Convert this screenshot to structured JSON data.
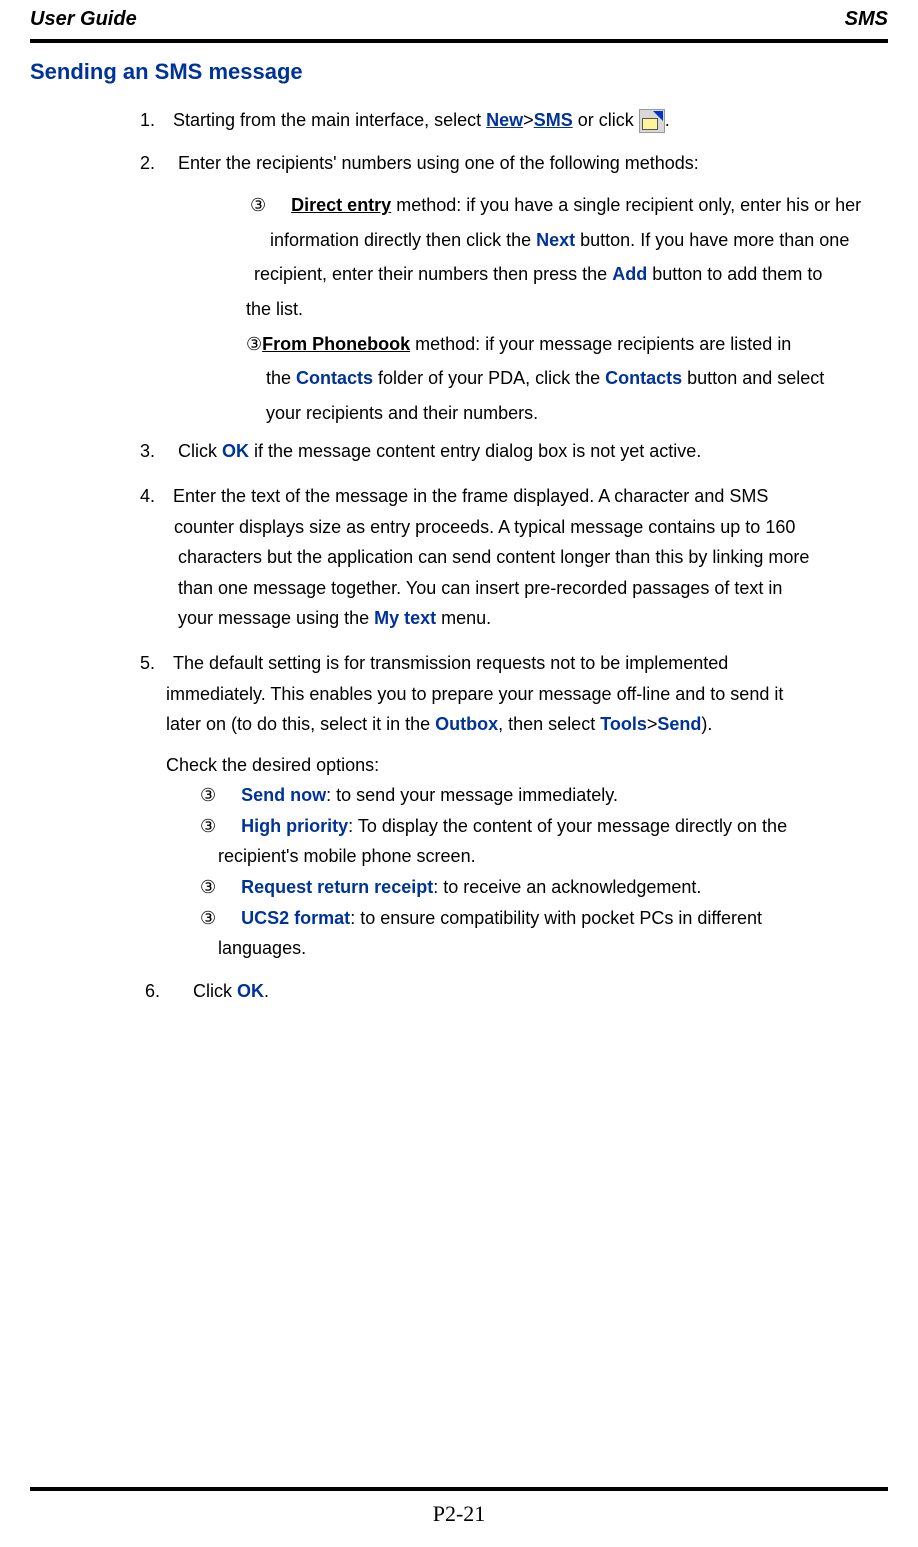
{
  "header": {
    "left": "User Guide",
    "right": "SMS"
  },
  "title": "Sending an SMS message",
  "steps": {
    "s1": {
      "num": "1.",
      "a": "Starting from the main interface, select ",
      "new": "New",
      "gt": ">",
      "sms": "SMS",
      "b": " or click  ",
      "end": "."
    },
    "s2": {
      "num": "2.",
      "text": "Enter the recipients' numbers using one of the following methods:",
      "bullet": "③",
      "direct_label": "Direct entry",
      "direct_a": " method: if you have a single recipient only, enter his or her",
      "direct_b": "information directly then click the ",
      "next": "Next",
      "direct_c": " button. If you have more than one",
      "direct_d": "recipient, enter their numbers then press the ",
      "add": "Add",
      "direct_e": " button to add them to",
      "direct_f": "the list.",
      "phonebook_label": "From Phonebook",
      "pb_a": " method: if your message recipients are listed in",
      "pb_b": "the ",
      "contacts": "Contacts",
      "pb_c": " folder of your PDA, click the ",
      "pb_d": " button and select",
      "pb_e": "your recipients and their numbers."
    },
    "s3": {
      "num": "3.",
      "a": "Click ",
      "ok": "OK",
      "b": " if the message content entry dialog box is not yet active."
    },
    "s4": {
      "num": "4.",
      "l1": "Enter the text of the message in the frame displayed. A character and SMS",
      "l2": "counter displays size as entry proceeds. A typical message contains up to 160",
      "l3": "characters but the application can send content longer than this by linking more",
      "l4": "than one message    together. You can insert pre-recorded passages of text in",
      "l5": "your message using the ",
      "mytext": "My text",
      "l5b": " menu."
    },
    "s5": {
      "num": "5.",
      "l1": "The default setting is for transmission requests not to be implemented",
      "l2": "immediately. This enables you to prepare your message off-line and to send it",
      "l3a": "later on (to do this, select it in the ",
      "outbox": "Outbox",
      "l3b": ", then select ",
      "tools": "Tools",
      "gt": ">",
      "send": "Send",
      "l3c": ").",
      "check": "Check the desired options:",
      "bullet": "③",
      "opt1_label": "Send now",
      "opt1_rest": ": to send your message immediately.",
      "opt2_label": "High priority",
      "opt2_rest": ": To display the content of your message directly on the",
      "opt2_cont": "recipient's mobile phone screen.",
      "opt3_label": "Request return receipt",
      "opt3_rest": ": to receive an acknowledgement.",
      "opt4_label": "UCS2 format",
      "opt4_rest": ": to ensure compatibility with pocket PCs in different",
      "opt4_cont": "languages."
    },
    "s6": {
      "num": "6.",
      "a": "Click ",
      "ok": "OK",
      "b": "."
    }
  },
  "footer": {
    "page_num": "P2-21"
  }
}
